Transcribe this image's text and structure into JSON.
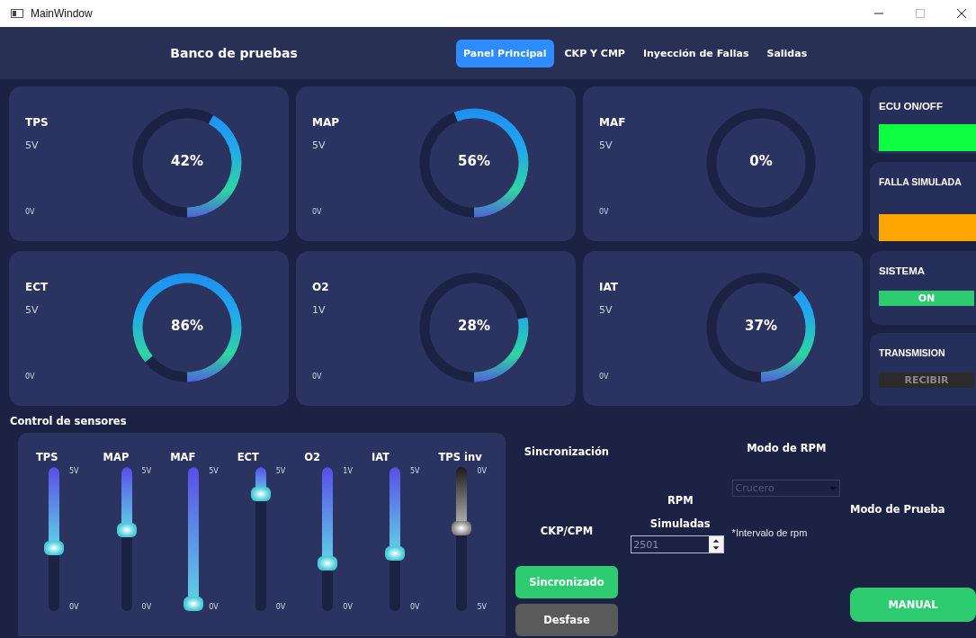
{
  "window": {
    "title": "MainWindow"
  },
  "header": {
    "title": "Banco de pruebas",
    "tabs": [
      {
        "label": "Panel Principal",
        "selected": true
      },
      {
        "label": "CKP Y CMP",
        "selected": false
      },
      {
        "label": "Inyección de Fallas",
        "selected": false
      },
      {
        "label": "Salidas",
        "selected": false
      }
    ]
  },
  "gauges": [
    {
      "name": "TPS",
      "max": "5V",
      "min": "0V",
      "reading": "42%"
    },
    {
      "name": "MAP",
      "max": "5V",
      "min": "0V",
      "reading": "56%"
    },
    {
      "name": "MAF",
      "max": "5V",
      "min": "0V",
      "reading": "0%"
    },
    {
      "name": "ECT",
      "max": "5V",
      "min": "0V",
      "reading": "86%"
    },
    {
      "name": "O2",
      "max": "1V",
      "min": "0V",
      "reading": "28%"
    },
    {
      "name": "IAT",
      "max": "5V",
      "min": "0V",
      "reading": "37%"
    }
  ],
  "indicators": [
    {
      "title": "ECU  ON/OFF",
      "color": "#0dff3f"
    },
    {
      "title": "FALLA SIMULADA",
      "color": "#ffa500"
    },
    {
      "title": "SISTEMA",
      "color": "#2ecc71",
      "label": "ON"
    },
    {
      "title": "TRANSMISION",
      "color": "#2b2b2b",
      "label": "RECIBIR"
    }
  ],
  "sensor_control": {
    "title": "Control de sensores",
    "sliders": [
      {
        "name": "TPS",
        "top": "5V",
        "bottom": "0V",
        "kind": "color"
      },
      {
        "name": "MAP",
        "top": "5V",
        "bottom": "0V",
        "kind": "color"
      },
      {
        "name": "MAF",
        "top": "5V",
        "bottom": "0V",
        "kind": "color"
      },
      {
        "name": "ECT",
        "top": "5V",
        "bottom": "0V",
        "kind": "color"
      },
      {
        "name": "O2",
        "top": "1V",
        "bottom": "0V",
        "kind": "color"
      },
      {
        "name": "IAT",
        "top": "5V",
        "bottom": "0V",
        "kind": "color"
      },
      {
        "name": "TPS inv",
        "top": "0V",
        "bottom": "5V",
        "kind": "gray"
      }
    ]
  },
  "sync": {
    "title": "Sincronización",
    "label": "CKP/CPM",
    "buttons": [
      {
        "label": "Sincronizado",
        "kind": "green"
      },
      {
        "label": "Desfase",
        "kind": "gray"
      }
    ]
  },
  "rpm": {
    "label_1": "RPM",
    "label_2": "Simuladas",
    "value": "2501"
  },
  "rpm_mode": {
    "title": "Modo de RPM",
    "value": "Crucero",
    "note": "*Intervalo de rpm"
  },
  "test_mode": {
    "title": "Modo de Prueba",
    "button": "MANUAL"
  }
}
